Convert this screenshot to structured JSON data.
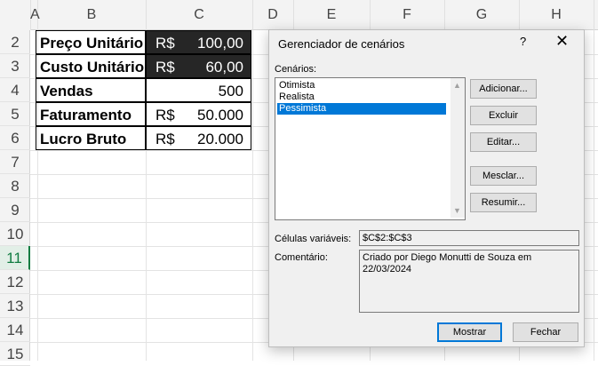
{
  "columns": [
    "A",
    "B",
    "C",
    "D",
    "E",
    "F",
    "G",
    "H"
  ],
  "rows": [
    "2",
    "3",
    "4",
    "5",
    "6",
    "7",
    "8",
    "9",
    "10",
    "11",
    "12",
    "13",
    "14",
    "15"
  ],
  "table": [
    {
      "label": "Preço Unitário",
      "currency": "R$",
      "value": "100,00"
    },
    {
      "label": "Custo Unitário",
      "currency": "R$",
      "value": "60,00"
    },
    {
      "label": "Vendas",
      "currency": "",
      "value": "500"
    },
    {
      "label": "Faturamento",
      "currency": "R$",
      "value": "50.000"
    },
    {
      "label": "Lucro Bruto",
      "currency": "R$",
      "value": "20.000"
    }
  ],
  "dialog": {
    "title": "Gerenciador de cenários",
    "help": "?",
    "close": "✕",
    "scenarios_label": "Cenários:",
    "scenarios": [
      "Otimista",
      "Realista",
      "Pessimista"
    ],
    "buttons": {
      "add": "Adicionar...",
      "delete": "Excluir",
      "edit": "Editar...",
      "merge": "Mesclar...",
      "summary": "Resumir..."
    },
    "changing_cells_label": "Células variáveis:",
    "changing_cells": "$C$2:$C$3",
    "comment_label": "Comentário:",
    "comment": "Criado por Diego Monutti de Souza em 22/03/2024",
    "show": "Mostrar",
    "close_button": "Fechar"
  }
}
